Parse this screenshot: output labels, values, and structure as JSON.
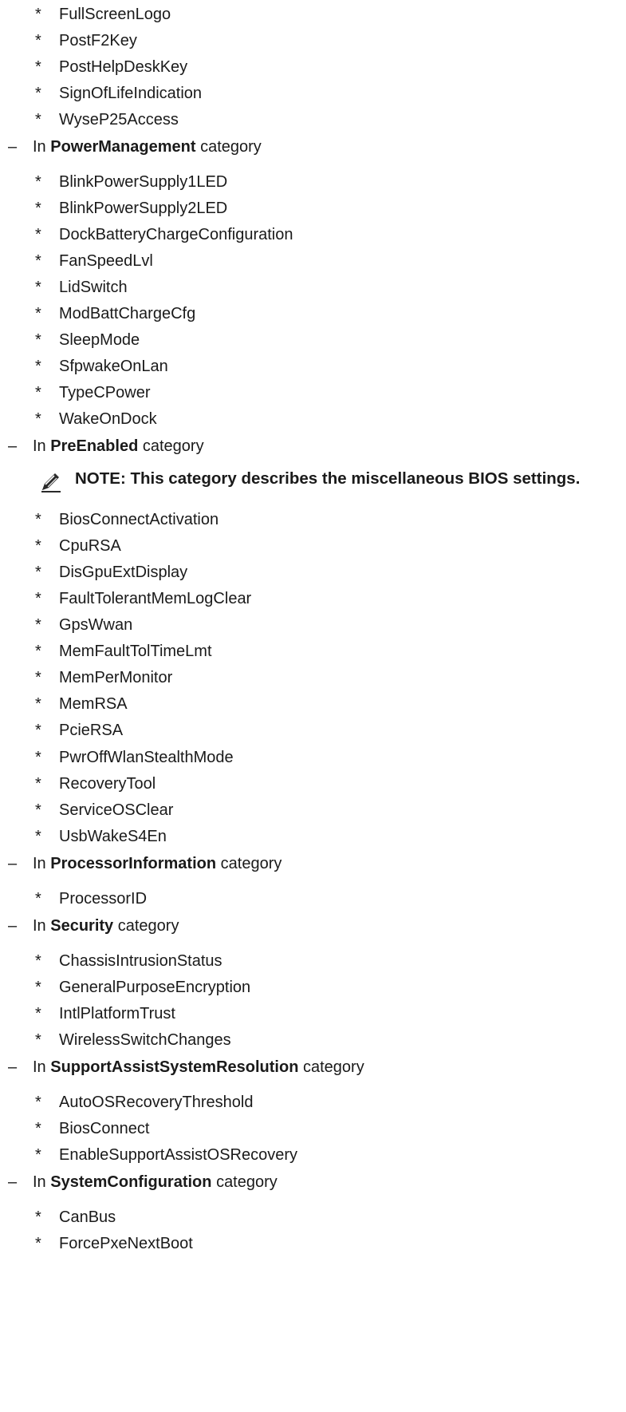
{
  "top_items": [
    "FullScreenLogo",
    "PostF2Key",
    "PostHelpDeskKey",
    "SignOfLifeIndication",
    "WyseP25Access"
  ],
  "prefix": "In",
  "suffix": "category",
  "dash": "–",
  "star": "*",
  "categories": [
    {
      "name": "PowerManagement",
      "items": [
        "BlinkPowerSupply1LED",
        "BlinkPowerSupply2LED",
        "DockBatteryChargeConfiguration",
        "FanSpeedLvl",
        "LidSwitch",
        "ModBattChargeCfg",
        "SleepMode",
        "SfpwakeOnLan",
        "TypeCPower",
        "WakeOnDock"
      ]
    },
    {
      "name": "PreEnabled",
      "note": "NOTE: This category describes the miscellaneous BIOS settings.",
      "items": [
        "BiosConnectActivation",
        "CpuRSA",
        "DisGpuExtDisplay",
        "FaultTolerantMemLogClear",
        "GpsWwan",
        "MemFaultTolTimeLmt",
        "MemPerMonitor",
        "MemRSA",
        "PcieRSA",
        "PwrOffWlanStealthMode",
        "RecoveryTool",
        "ServiceOSClear",
        "UsbWakeS4En"
      ]
    },
    {
      "name": "ProcessorInformation",
      "items": [
        "ProcessorID"
      ]
    },
    {
      "name": "Security",
      "items": [
        "ChassisIntrusionStatus",
        "GeneralPurposeEncryption",
        "IntlPlatformTrust",
        "WirelessSwitchChanges"
      ]
    },
    {
      "name": "SupportAssistSystemResolution",
      "items": [
        "AutoOSRecoveryThreshold",
        "BiosConnect",
        "EnableSupportAssistOSRecovery"
      ]
    },
    {
      "name": "SystemConfiguration",
      "items": [
        "CanBus",
        "ForcePxeNextBoot"
      ]
    }
  ]
}
